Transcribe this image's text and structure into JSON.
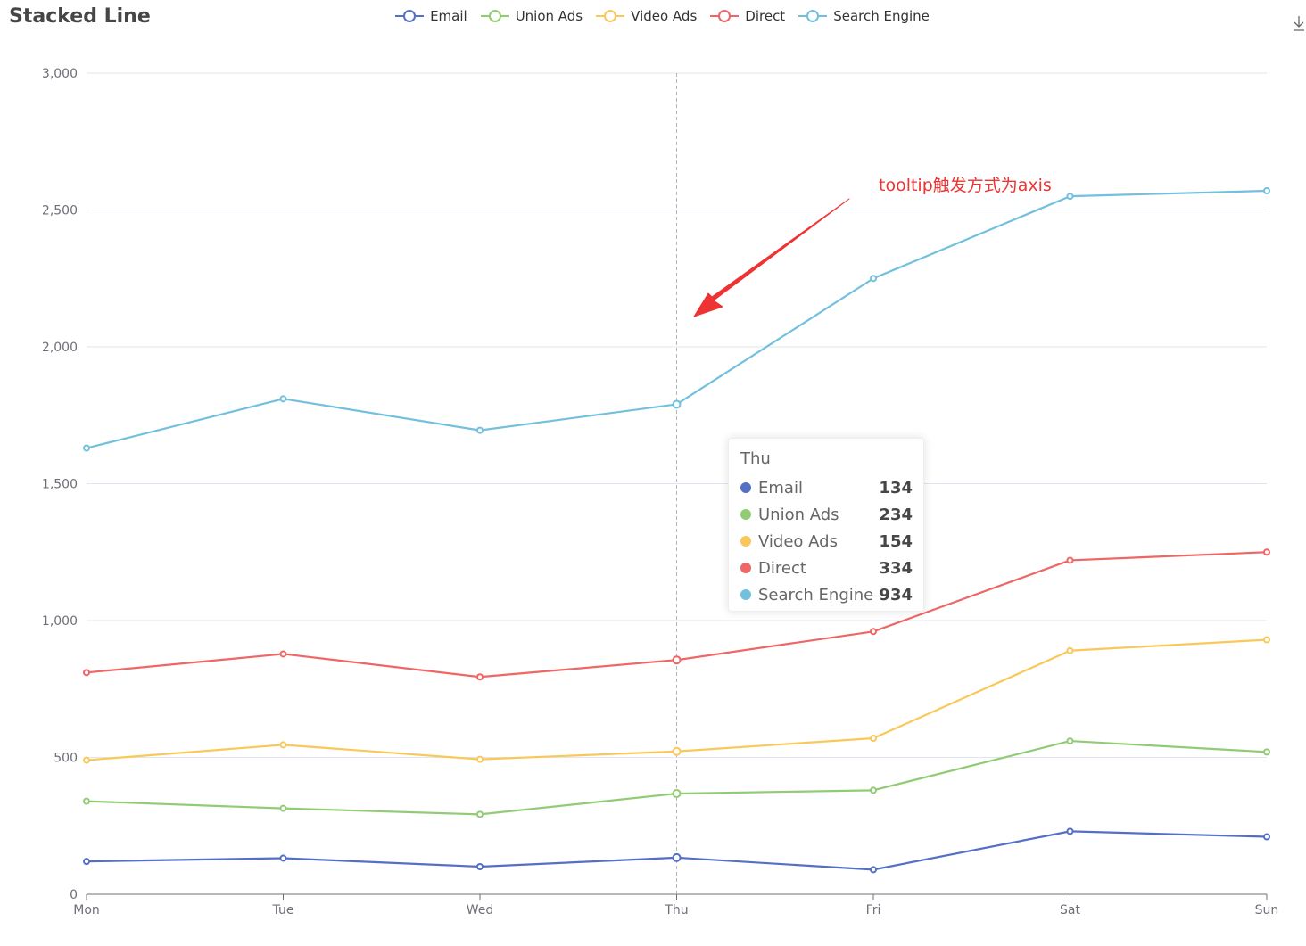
{
  "chart_data": {
    "type": "line",
    "title": "Stacked Line",
    "stacked": true,
    "categories": [
      "Mon",
      "Tue",
      "Wed",
      "Thu",
      "Fri",
      "Sat",
      "Sun"
    ],
    "series": [
      {
        "name": "Email",
        "values": [
          120,
          132,
          101,
          134,
          90,
          230,
          210
        ]
      },
      {
        "name": "Union Ads",
        "values": [
          220,
          182,
          191,
          234,
          290,
          330,
          310
        ]
      },
      {
        "name": "Video Ads",
        "values": [
          150,
          232,
          201,
          154,
          190,
          330,
          410
        ]
      },
      {
        "name": "Direct",
        "values": [
          320,
          332,
          301,
          334,
          390,
          330,
          320
        ]
      },
      {
        "name": "Search Engine",
        "values": [
          820,
          932,
          901,
          934,
          1290,
          1330,
          1320
        ]
      }
    ],
    "ylim": [
      0,
      3000
    ],
    "yticks": [
      0,
      500,
      1000,
      1500,
      2000,
      2500,
      3000
    ],
    "ytick_labels": [
      "0",
      "500",
      "1,000",
      "1,500",
      "2,000",
      "2,500",
      "3,000"
    ],
    "grid": true,
    "legend_position": "top-center",
    "colors": [
      "#5470c6",
      "#91cc75",
      "#fac858",
      "#ee6666",
      "#73c0de"
    ]
  },
  "tooltip": {
    "title": "Thu",
    "rows": [
      {
        "name": "Email",
        "value": "134"
      },
      {
        "name": "Union Ads",
        "value": "234"
      },
      {
        "name": "Video Ads",
        "value": "154"
      },
      {
        "name": "Direct",
        "value": "334"
      },
      {
        "name": "Search Engine",
        "value": "934"
      }
    ]
  },
  "annotation": {
    "text": "tooltip触发方式为axis",
    "color": "#ee3333"
  },
  "toolbox": {
    "icon": "download-icon"
  }
}
